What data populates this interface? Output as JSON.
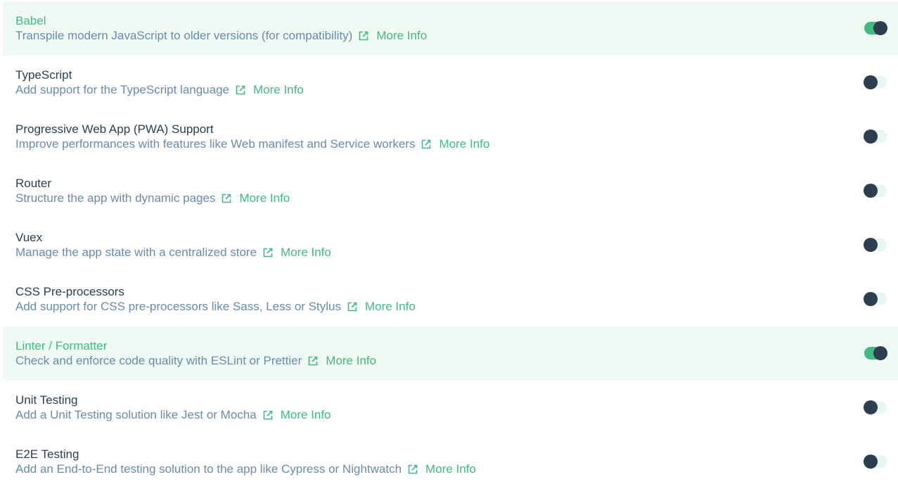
{
  "colors": {
    "accent": "#42b983",
    "selected_background": "#effaf4",
    "title_text": "#2c3e50",
    "description_text": "#6a8bad",
    "toggle_knob": "#2c3e50",
    "toggle_track_off": "#e8f6ef"
  },
  "features": [
    {
      "name": "Babel",
      "description": "Transpile modern JavaScript to older versions (for compatibility)",
      "link_label": "More Info",
      "link_icon": "external-link-icon",
      "enabled": true
    },
    {
      "name": "TypeScript",
      "description": "Add support for the TypeScript language",
      "link_label": "More Info",
      "link_icon": "external-link-icon",
      "enabled": false
    },
    {
      "name": "Progressive Web App (PWA) Support",
      "description": "Improve performances with features like Web manifest and Service workers",
      "link_label": "More Info",
      "link_icon": "external-link-icon",
      "enabled": false
    },
    {
      "name": "Router",
      "description": "Structure the app with dynamic pages",
      "link_label": "More Info",
      "link_icon": "external-link-icon",
      "enabled": false
    },
    {
      "name": "Vuex",
      "description": "Manage the app state with a centralized store",
      "link_label": "More Info",
      "link_icon": "external-link-icon",
      "enabled": false
    },
    {
      "name": "CSS Pre-processors",
      "description": "Add support for CSS pre-processors like Sass, Less or Stylus",
      "link_label": "More Info",
      "link_icon": "external-link-icon",
      "enabled": false
    },
    {
      "name": "Linter / Formatter",
      "description": "Check and enforce code quality with ESLint or Prettier",
      "link_label": "More Info",
      "link_icon": "external-link-icon",
      "enabled": true
    },
    {
      "name": "Unit Testing",
      "description": "Add a Unit Testing solution like Jest or Mocha",
      "link_label": "More Info",
      "link_icon": "external-link-icon",
      "enabled": false
    },
    {
      "name": "E2E Testing",
      "description": "Add an End-to-End testing solution to the app like Cypress or Nightwatch",
      "link_label": "More Info",
      "link_icon": "external-link-icon",
      "enabled": false
    }
  ]
}
